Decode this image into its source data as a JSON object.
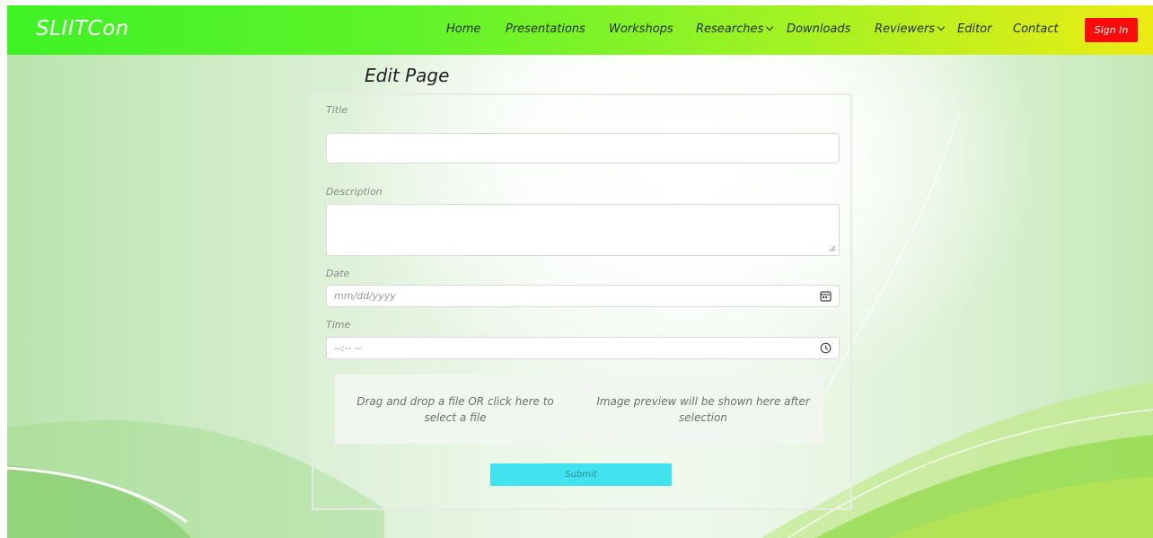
{
  "navbar": {
    "brand": "SLIITCon",
    "items": [
      {
        "label": "Home"
      },
      {
        "label": "Presentations"
      },
      {
        "label": "Workshops"
      },
      {
        "label": "Researches",
        "dropdown": true
      },
      {
        "label": "Downloads"
      },
      {
        "label": "Reviewers",
        "dropdown": true
      },
      {
        "label": "Editor"
      },
      {
        "label": "Contact"
      }
    ],
    "signin_label": "Sign In"
  },
  "form": {
    "heading": "Edit Page",
    "title_label": "Title",
    "title_value": "",
    "description_label": "Description",
    "description_value": "",
    "date_label": "Date",
    "date_placeholder": "mm/dd/yyyy",
    "time_label": "Time",
    "time_placeholder": "--:-- --",
    "dropzone_text": "Drag and drop a file OR click here to select a file",
    "preview_text": "Image preview will be shown here after selection",
    "submit_label": "Submit"
  },
  "icons": {
    "date": "calendar-icon",
    "time": "clock-icon"
  },
  "colors": {
    "navbar_start": "#3ef224",
    "navbar_end": "#ecec14",
    "signin_bg": "#ff0a0a",
    "submit_bg": "#41e3ee"
  }
}
